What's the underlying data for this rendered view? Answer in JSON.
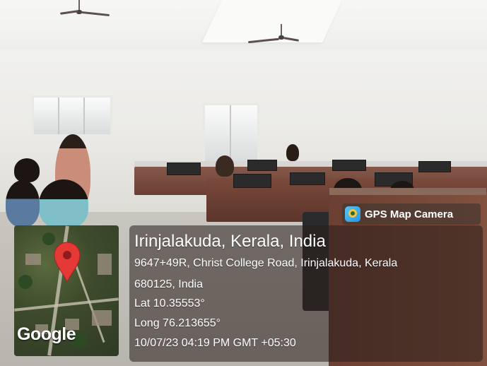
{
  "badge": {
    "label": "GPS Map Camera",
    "icon": "gps-map-camera-app-icon"
  },
  "location": {
    "title": "Irinjalakuda, Kerala, India",
    "address_line1": "9647+49R, Christ College Road, Irinjalakuda, Kerala",
    "address_line2": "680125, India",
    "lat": "Lat 10.35553°",
    "long": "Long 76.213655°",
    "datetime": "10/07/23 04:19 PM GMT +05:30"
  },
  "map": {
    "provider_logo": "Google",
    "pin_icon": "location-pin-icon",
    "pin_color": "#e53935"
  }
}
